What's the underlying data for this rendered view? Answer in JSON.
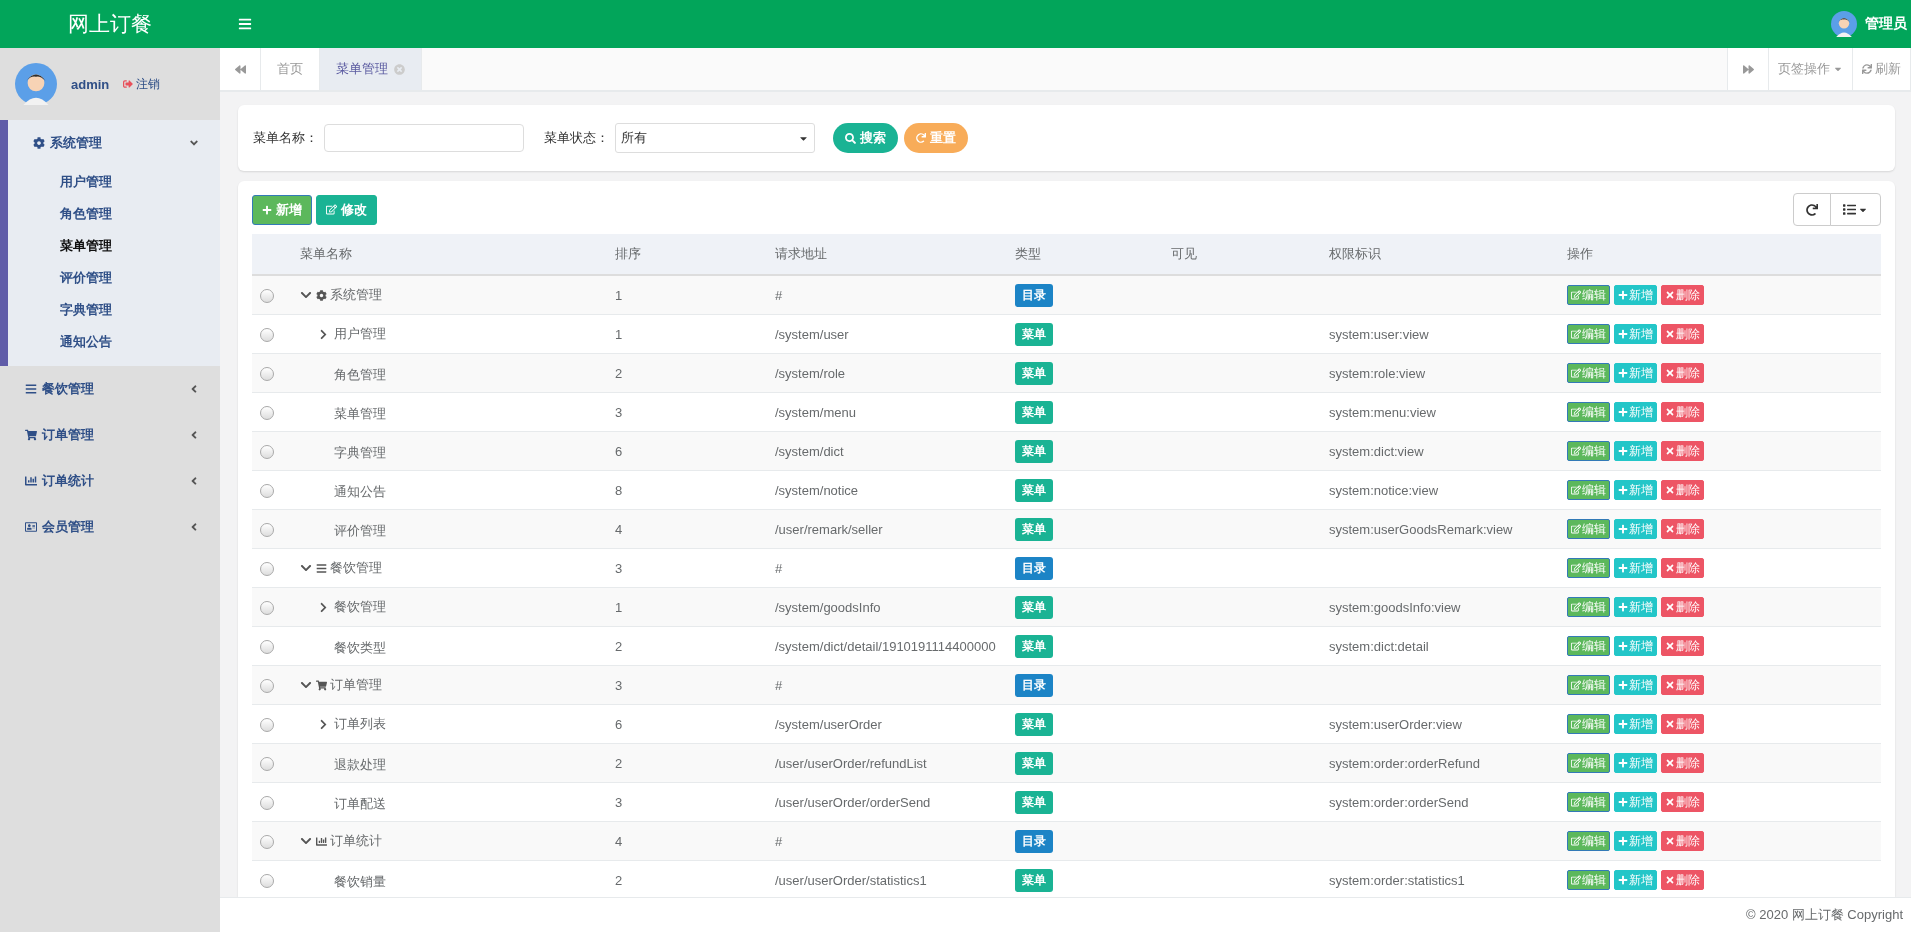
{
  "header": {
    "title": "网上订餐",
    "user": "管理员"
  },
  "sidebar": {
    "username": "admin",
    "logout": "注销",
    "groups": [
      {
        "label": "系统管理",
        "expanded": true,
        "items": [
          {
            "label": "用户管理",
            "selected": false
          },
          {
            "label": "角色管理",
            "selected": false
          },
          {
            "label": "菜单管理",
            "selected": true
          },
          {
            "label": "评价管理",
            "selected": false
          },
          {
            "label": "字典管理",
            "selected": false
          },
          {
            "label": "通知公告",
            "selected": false
          }
        ]
      },
      {
        "label": "餐饮管理",
        "expanded": false
      },
      {
        "label": "订单管理",
        "expanded": false
      },
      {
        "label": "订单统计",
        "expanded": false
      },
      {
        "label": "会员管理",
        "expanded": false
      }
    ]
  },
  "tabs": [
    {
      "label": "首页",
      "selected": false,
      "closable": false
    },
    {
      "label": "菜单管理",
      "selected": true,
      "closable": true
    }
  ],
  "tab_actions": {
    "menu": "页签操作",
    "refresh": "刷新"
  },
  "search": {
    "fields": [
      {
        "label": "菜单名称：",
        "kind": "text"
      },
      {
        "label": "菜单状态：",
        "kind": "select",
        "value": "所有"
      }
    ],
    "buttons": [
      "搜索",
      "重置"
    ]
  },
  "toolbar": {
    "buttons": [
      "新增",
      "修改"
    ]
  },
  "table": {
    "columns": [
      "菜单名称",
      "排序",
      "请求地址",
      "类型",
      "可见",
      "权限标识",
      "操作"
    ],
    "rows": [
      {
        "name": "系统管理",
        "order": "1",
        "url": "#",
        "type": {
          "kind": "directory",
          "label": "目录"
        },
        "perms": "",
        "selected": false,
        "expanded": true,
        "actions": [
          "编辑",
          "新增",
          "删除"
        ],
        "children": [
          {
            "name": "用户管理",
            "order": "1",
            "url": "/system/user",
            "type": {
              "kind": "menu",
              "label": "菜单"
            },
            "perms": "system:user:view",
            "selected": false,
            "expanded": false,
            "actions": [
              "编辑",
              "新增",
              "删除"
            ]
          },
          {
            "name": "角色管理",
            "order": "2",
            "url": "/system/role",
            "type": {
              "kind": "menu",
              "label": "菜单"
            },
            "perms": "system:role:view",
            "selected": false,
            "actions": [
              "编辑",
              "新增",
              "删除"
            ]
          },
          {
            "name": "菜单管理",
            "order": "3",
            "url": "/system/menu",
            "type": {
              "kind": "menu",
              "label": "菜单"
            },
            "perms": "system:menu:view",
            "selected": false,
            "actions": [
              "编辑",
              "新增",
              "删除"
            ]
          },
          {
            "name": "字典管理",
            "order": "6",
            "url": "/system/dict",
            "type": {
              "kind": "menu",
              "label": "菜单"
            },
            "perms": "system:dict:view",
            "selected": false,
            "actions": [
              "编辑",
              "新增",
              "删除"
            ]
          },
          {
            "name": "通知公告",
            "order": "8",
            "url": "/system/notice",
            "type": {
              "kind": "menu",
              "label": "菜单"
            },
            "perms": "system:notice:view",
            "selected": false,
            "actions": [
              "编辑",
              "新增",
              "删除"
            ]
          },
          {
            "name": "评价管理",
            "order": "4",
            "url": "/user/remark/seller",
            "type": {
              "kind": "menu",
              "label": "菜单"
            },
            "perms": "system:userGoodsRemark:view",
            "selected": false,
            "actions": [
              "编辑",
              "新增",
              "删除"
            ]
          }
        ]
      },
      {
        "name": "餐饮管理",
        "order": "3",
        "url": "#",
        "type": {
          "kind": "directory",
          "label": "目录"
        },
        "perms": "",
        "selected": false,
        "expanded": true,
        "actions": [
          "编辑",
          "新增",
          "删除"
        ],
        "children": [
          {
            "name": "餐饮管理",
            "order": "1",
            "url": "/system/goodsInfo",
            "type": {
              "kind": "menu",
              "label": "菜单"
            },
            "perms": "system:goodsInfo:view",
            "selected": false,
            "expanded": false,
            "actions": [
              "编辑",
              "新增",
              "删除"
            ]
          },
          {
            "name": "餐饮类型",
            "order": "2",
            "url": "/system/dict/detail/1910191114400000",
            "type": {
              "kind": "menu",
              "label": "菜单"
            },
            "perms": "system:dict:detail",
            "selected": false,
            "actions": [
              "编辑",
              "新增",
              "删除"
            ]
          }
        ]
      },
      {
        "name": "订单管理",
        "order": "3",
        "url": "#",
        "type": {
          "kind": "directory",
          "label": "目录"
        },
        "perms": "",
        "selected": false,
        "expanded": true,
        "actions": [
          "编辑",
          "新增",
          "删除"
        ],
        "children": [
          {
            "name": "订单列表",
            "order": "6",
            "url": "/system/userOrder",
            "type": {
              "kind": "menu",
              "label": "菜单"
            },
            "perms": "system:userOrder:view",
            "selected": false,
            "expanded": false,
            "actions": [
              "编辑",
              "新增",
              "删除"
            ]
          },
          {
            "name": "退款处理",
            "order": "2",
            "url": "/user/userOrder/refundList",
            "type": {
              "kind": "menu",
              "label": "菜单"
            },
            "perms": "system:order:orderRefund",
            "selected": false,
            "actions": [
              "编辑",
              "新增",
              "删除"
            ]
          },
          {
            "name": "订单配送",
            "order": "3",
            "url": "/user/userOrder/orderSend",
            "type": {
              "kind": "menu",
              "label": "菜单"
            },
            "perms": "system:order:orderSend",
            "selected": false,
            "actions": [
              "编辑",
              "新增",
              "删除"
            ]
          }
        ]
      },
      {
        "name": "订单统计",
        "order": "4",
        "url": "#",
        "type": {
          "kind": "directory",
          "label": "目录"
        },
        "perms": "",
        "selected": false,
        "expanded": true,
        "actions": [
          "编辑",
          "新增",
          "删除"
        ],
        "children": [
          {
            "name": "餐饮销量",
            "order": "2",
            "url": "/user/userOrder/statistics1",
            "type": {
              "kind": "menu",
              "label": "菜单"
            },
            "perms": "system:order:statistics1",
            "selected": false,
            "actions": [
              "编辑",
              "新增",
              "删除"
            ]
          }
        ]
      }
    ]
  },
  "footer": "© 2020 网上订餐 Copyright"
}
